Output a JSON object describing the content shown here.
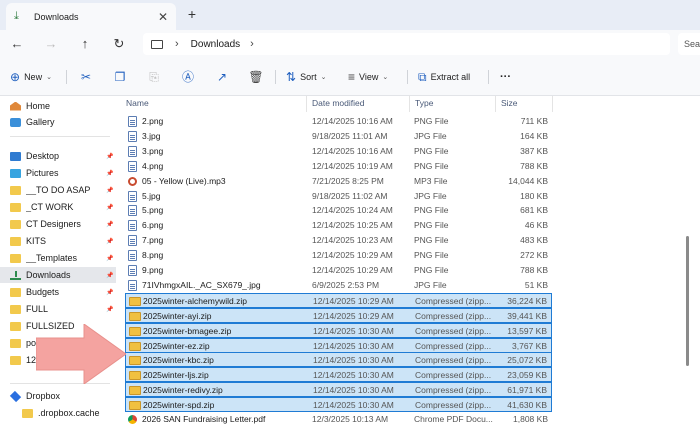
{
  "window": {
    "tab_title": "Downloads",
    "address": "Downloads",
    "search_placeholder": "Sea"
  },
  "toolbar": {
    "new_label": "New",
    "sort_label": "Sort",
    "view_label": "View",
    "extract_label": "Extract all",
    "more_label": "···"
  },
  "sidebar": {
    "items": [
      {
        "label": "Home",
        "icon": "home-icon",
        "pinned": false
      },
      {
        "label": "Gallery",
        "icon": "gallery-icon",
        "pinned": false
      },
      {
        "label": "Desktop",
        "icon": "desktop-icon",
        "pinned": true
      },
      {
        "label": "Pictures",
        "icon": "pictures-icon",
        "pinned": true
      },
      {
        "label": "__TO DO ASAP",
        "icon": "folder-icon",
        "pinned": true
      },
      {
        "label": "_CT WORK",
        "icon": "folder-icon",
        "pinned": true
      },
      {
        "label": "CT Designers",
        "icon": "folder-icon",
        "pinned": true
      },
      {
        "label": "KITS",
        "icon": "folder-icon",
        "pinned": true
      },
      {
        "label": "__Templates",
        "icon": "folder-icon",
        "pinned": true
      },
      {
        "label": "Downloads",
        "icon": "downloads-icon",
        "pinned": true
      },
      {
        "label": "Budgets",
        "icon": "folder-icon",
        "pinned": true
      },
      {
        "label": "FULL",
        "icon": "folder-icon",
        "pinned": true
      },
      {
        "label": "FULLSIZED",
        "icon": "folder-icon",
        "pinned": false
      },
      {
        "label": "pon",
        "icon": "folder-icon",
        "pinned": false
      },
      {
        "label": "12-",
        "icon": "folder-icon",
        "pinned": false
      },
      {
        "label": "Dropbox",
        "icon": "dropbox-icon",
        "pinned": false
      },
      {
        "label": ".dropbox.cache",
        "icon": "folder-icon",
        "pinned": false
      }
    ]
  },
  "columns": {
    "name": "Name",
    "date": "Date modified",
    "type": "Type",
    "size": "Size"
  },
  "files": [
    {
      "name": "2.png",
      "date": "12/14/2025 10:16 AM",
      "type": "PNG File",
      "size": "711 KB",
      "kind": "doc",
      "selected": false
    },
    {
      "name": "3.jpg",
      "date": "9/18/2025 11:01 AM",
      "type": "JPG File",
      "size": "164 KB",
      "kind": "doc",
      "selected": false
    },
    {
      "name": "3.png",
      "date": "12/14/2025 10:16 AM",
      "type": "PNG File",
      "size": "387 KB",
      "kind": "doc",
      "selected": false
    },
    {
      "name": "4.png",
      "date": "12/14/2025 10:19 AM",
      "type": "PNG File",
      "size": "788 KB",
      "kind": "doc",
      "selected": false
    },
    {
      "name": "05 - Yellow (Live).mp3",
      "date": "7/21/2025 8:25 PM",
      "type": "MP3 File",
      "size": "14,044 KB",
      "kind": "mp3",
      "selected": false
    },
    {
      "name": "5.jpg",
      "date": "9/18/2025 11:02 AM",
      "type": "JPG File",
      "size": "180 KB",
      "kind": "doc",
      "selected": false
    },
    {
      "name": "5.png",
      "date": "12/14/2025 10:24 AM",
      "type": "PNG File",
      "size": "681 KB",
      "kind": "doc",
      "selected": false
    },
    {
      "name": "6.png",
      "date": "12/14/2025 10:25 AM",
      "type": "PNG File",
      "size": "46 KB",
      "kind": "doc",
      "selected": false
    },
    {
      "name": "7.png",
      "date": "12/14/2025 10:23 AM",
      "type": "PNG File",
      "size": "483 KB",
      "kind": "doc",
      "selected": false
    },
    {
      "name": "8.png",
      "date": "12/14/2025 10:29 AM",
      "type": "PNG File",
      "size": "272 KB",
      "kind": "doc",
      "selected": false
    },
    {
      "name": "9.png",
      "date": "12/14/2025 10:29 AM",
      "type": "PNG File",
      "size": "788 KB",
      "kind": "doc",
      "selected": false
    },
    {
      "name": "71IVhmgxAIL._AC_SX679_.jpg",
      "date": "6/9/2025 2:53 PM",
      "type": "JPG File",
      "size": "51 KB",
      "kind": "doc",
      "selected": false
    },
    {
      "name": "2025winter-alchemywild.zip",
      "date": "12/14/2025 10:29 AM",
      "type": "Compressed (zipp...",
      "size": "36,224 KB",
      "kind": "zip",
      "selected": true
    },
    {
      "name": "2025winter-ayi.zip",
      "date": "12/14/2025 10:29 AM",
      "type": "Compressed (zipp...",
      "size": "39,441 KB",
      "kind": "zip",
      "selected": true
    },
    {
      "name": "2025winter-bmagee.zip",
      "date": "12/14/2025 10:30 AM",
      "type": "Compressed (zipp...",
      "size": "13,597 KB",
      "kind": "zip",
      "selected": true
    },
    {
      "name": "2025winter-ez.zip",
      "date": "12/14/2025 10:30 AM",
      "type": "Compressed (zipp...",
      "size": "3,767 KB",
      "kind": "zip",
      "selected": true
    },
    {
      "name": "2025winter-kbc.zip",
      "date": "12/14/2025 10:30 AM",
      "type": "Compressed (zipp...",
      "size": "25,072 KB",
      "kind": "zip",
      "selected": true
    },
    {
      "name": "2025winter-ljs.zip",
      "date": "12/14/2025 10:30 AM",
      "type": "Compressed (zipp...",
      "size": "23,059 KB",
      "kind": "zip",
      "selected": true
    },
    {
      "name": "2025winter-redivy.zip",
      "date": "12/14/2025 10:30 AM",
      "type": "Compressed (zipp...",
      "size": "61,971 KB",
      "kind": "zip",
      "selected": true
    },
    {
      "name": "2025winter-spd.zip",
      "date": "12/14/2025 10:30 AM",
      "type": "Compressed (zipp...",
      "size": "41,630 KB",
      "kind": "zip",
      "selected": true
    },
    {
      "name": "2026 SAN Fundraising Letter.pdf",
      "date": "12/3/2025 10:13 AM",
      "type": "Chrome PDF Docu...",
      "size": "1,808 KB",
      "kind": "pdf",
      "selected": false
    }
  ],
  "colors": {
    "selection_bg": "#cce4f7",
    "selection_border": "#1f7bd4",
    "accent": "#1f5fbf",
    "arrow": "#f4a3a0"
  }
}
